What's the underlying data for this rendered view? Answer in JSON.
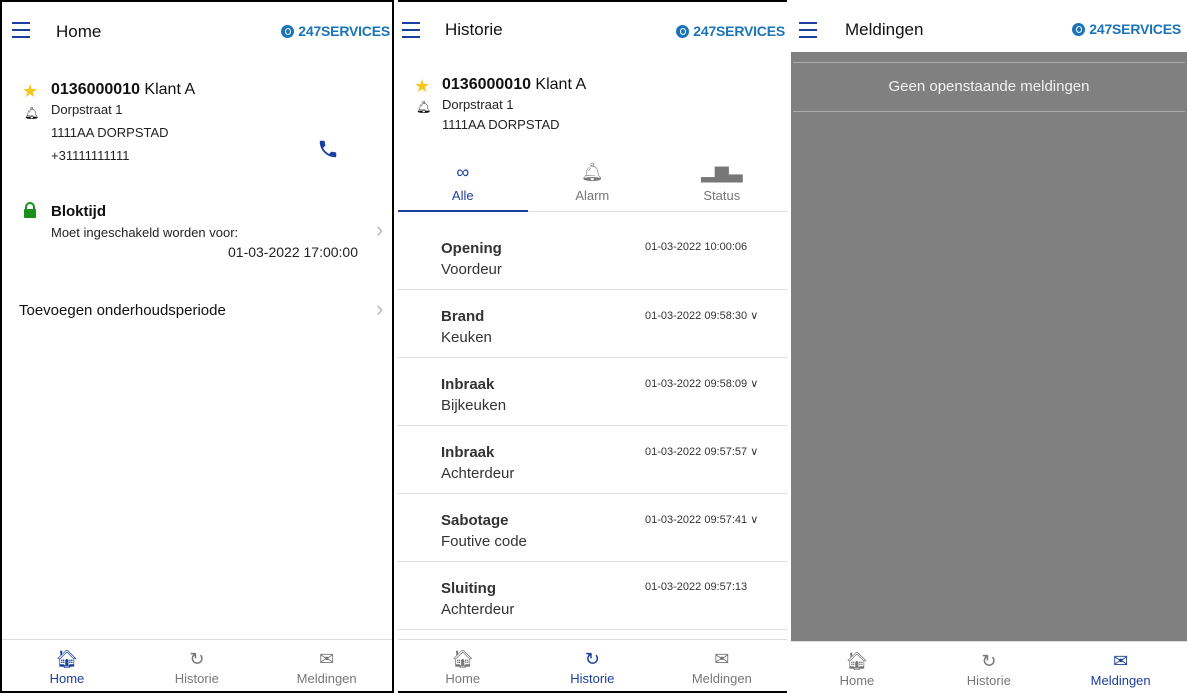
{
  "brand": "247SERVICES",
  "account": {
    "number": "0136000010",
    "name": " Klant A",
    "street": "Dorpstraat 1",
    "city": "1111AA DORPSTAD",
    "phone": "+31111111111"
  },
  "home": {
    "title": "Home",
    "block_title": "Bloktijd",
    "block_text": "Moet ingeschakeld worden voor:",
    "block_time": "01-03-2022 17:00:00",
    "maintenance": "Toevoegen onderhoudsperiode"
  },
  "history": {
    "title": "Historie",
    "tabs": [
      "Alle",
      "Alarm",
      "Status"
    ],
    "events": [
      {
        "title": "Opening",
        "detail": "Voordeur",
        "time": "01-03-2022 10:00:06",
        "chevron": ""
      },
      {
        "title": "Brand",
        "detail": "Keuken",
        "time": "01-03-2022 09:58:30",
        "chevron": "∨"
      },
      {
        "title": "Inbraak",
        "detail": "Bijkeuken",
        "time": "01-03-2022 09:58:09",
        "chevron": "∨"
      },
      {
        "title": "Inbraak",
        "detail": "Achterdeur",
        "time": "01-03-2022 09:57:57",
        "chevron": "∨"
      },
      {
        "title": "Sabotage",
        "detail": "Foutive code",
        "time": "01-03-2022 09:57:41",
        "chevron": "∨"
      },
      {
        "title": "Sluiting",
        "detail": "Achterdeur",
        "time": "01-03-2022 09:57:13",
        "chevron": ""
      }
    ]
  },
  "notifications": {
    "title": "Meldingen",
    "empty": "Geen openstaande meldingen"
  },
  "nav": {
    "home": "Home",
    "history": "Historie",
    "notifications": "Meldingen"
  },
  "colors": {
    "accent": "#1b3f9c",
    "brand": "#1b74b8",
    "star": "#f5c518",
    "lock": "#1a8f1a",
    "grey_panel": "#808080"
  }
}
